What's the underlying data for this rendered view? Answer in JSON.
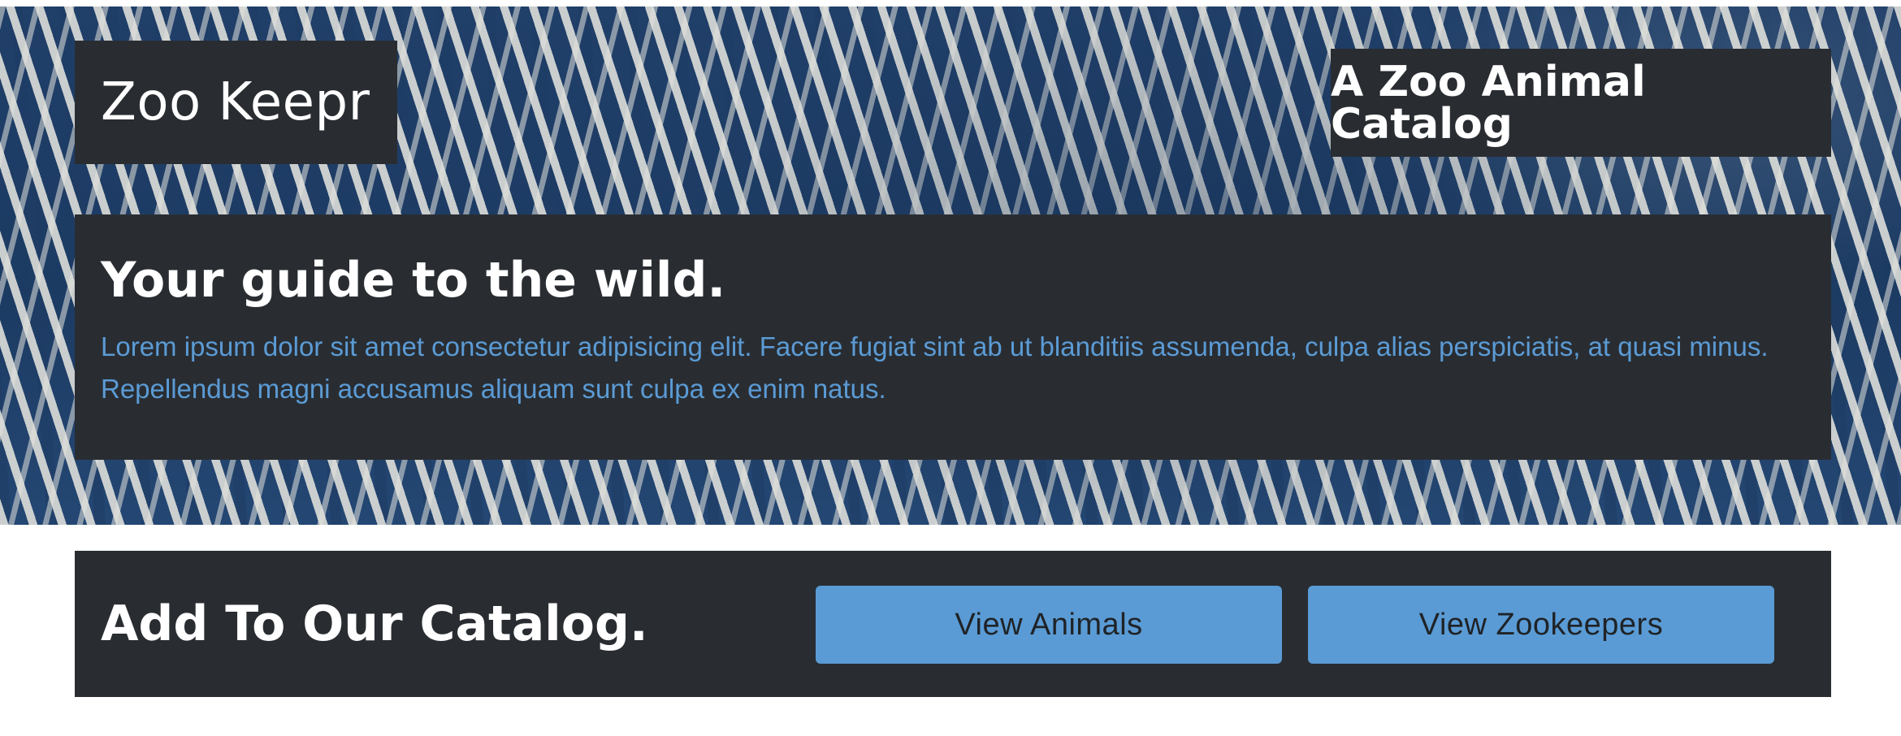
{
  "header": {
    "brand": "Zoo Keepr",
    "tagline": "A Zoo Animal Catalog"
  },
  "intro": {
    "heading": "Your guide to the wild.",
    "body": "Lorem ipsum dolor sit amet consectetur adipisicing elit. Facere fugiat sint ab ut blanditiis assumenda, culpa alias perspiciatis, at quasi minus. Repellendus magni accusamus aliquam sunt culpa ex enim natus."
  },
  "catalog": {
    "heading": "Add To Our Catalog.",
    "buttons": [
      {
        "label": "View Animals"
      },
      {
        "label": "View Zookeepers"
      }
    ]
  },
  "colors": {
    "panel": "#292d32",
    "accent": "#5a9bd5",
    "hero_background": "#1f3f6a"
  }
}
